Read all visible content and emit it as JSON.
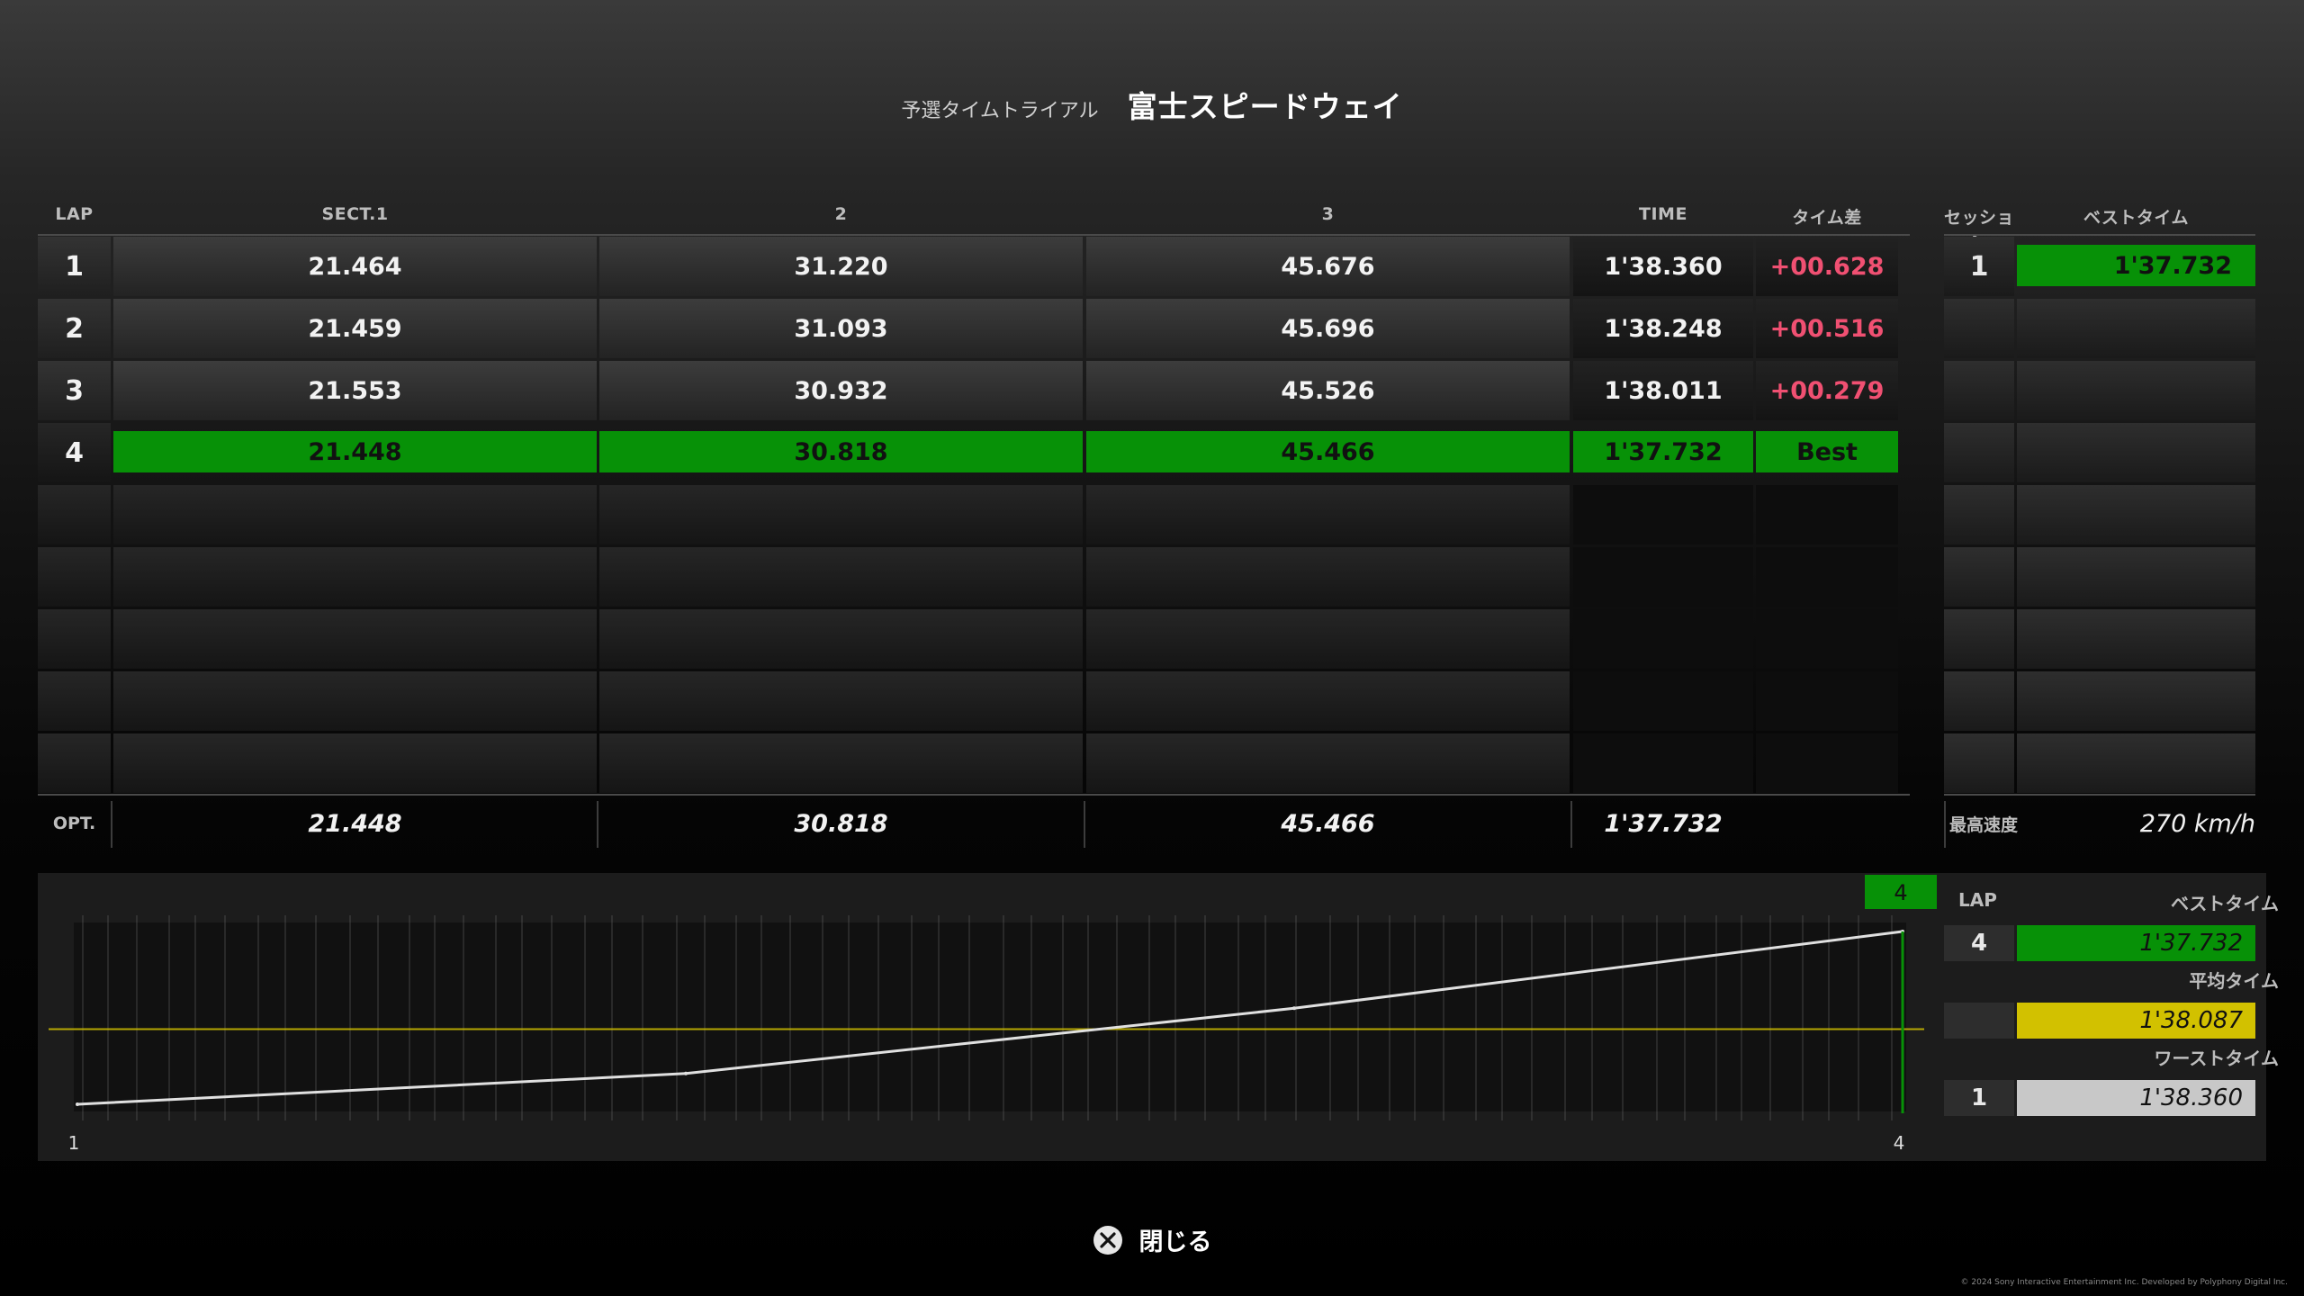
{
  "title": {
    "sub": "予選タイムトライアル",
    "main": "富士スピードウェイ"
  },
  "headers": {
    "lap": "LAP",
    "s1": "SECT.1",
    "s2": "2",
    "s3": "3",
    "time": "TIME",
    "diff": "タイム差",
    "session": "セッション",
    "best": "ベストタイム"
  },
  "laps": [
    {
      "lap": "1",
      "s1": "21.464",
      "s2": "31.220",
      "s3": "45.676",
      "time": "1'38.360",
      "diff": "+00.628"
    },
    {
      "lap": "2",
      "s1": "21.459",
      "s2": "31.093",
      "s3": "45.696",
      "time": "1'38.248",
      "diff": "+00.516"
    },
    {
      "lap": "3",
      "s1": "21.553",
      "s2": "30.932",
      "s3": "45.526",
      "time": "1'38.011",
      "diff": "+00.279"
    },
    {
      "lap": "4",
      "s1": "21.448",
      "s2": "30.818",
      "s3": "45.466",
      "time": "1'37.732",
      "diff": "Best"
    }
  ],
  "session": {
    "num": "1",
    "best": "1'37.732"
  },
  "opt": {
    "label": "OPT.",
    "s1": "21.448",
    "s2": "30.818",
    "s3": "45.466",
    "time": "1'37.732"
  },
  "top_speed": {
    "label": "最高速度",
    "value": "270 km/h"
  },
  "graph": {
    "marker": "4",
    "x_start": "1",
    "x_end": "4",
    "chart_data": {
      "type": "line",
      "x": [
        1,
        2,
        3,
        4
      ],
      "y": [
        "1'38.360",
        "1'38.248",
        "1'38.011",
        "1'37.732"
      ],
      "y_seconds": [
        98.36,
        98.248,
        98.011,
        97.732
      ],
      "average_line": 98.087
    }
  },
  "summary": {
    "lap_label": "LAP",
    "best_label": "ベストタイム",
    "best_lap": "4",
    "best_time": "1'37.732",
    "avg_label": "平均タイム",
    "avg_time": "1'38.087",
    "worst_label": "ワーストタイム",
    "worst_lap": "1",
    "worst_time": "1'38.360"
  },
  "footer": {
    "close_label": "閉じる",
    "copyright": "© 2024 Sony Interactive Entertainment Inc. Developed by Polyphony Digital Inc."
  },
  "colors": {
    "best": "#079107",
    "average": "#d2c100",
    "worst": "#c8c8c8",
    "diff_red": "#f05072"
  }
}
